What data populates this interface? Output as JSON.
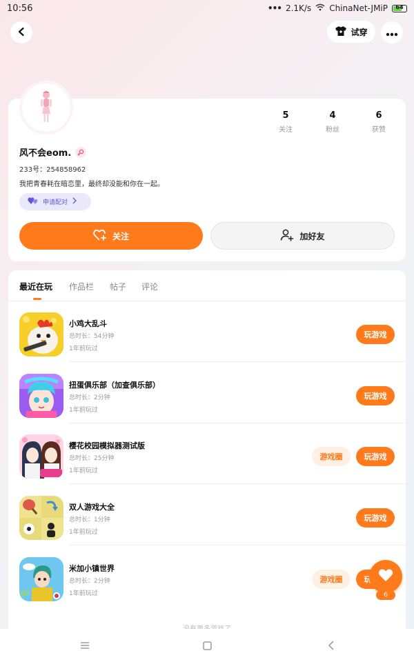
{
  "status_bar": {
    "time": "10:56",
    "speed": "2.1K/s",
    "network": "ChinaNet-JMiP",
    "battery": "64",
    "battery_level": 0.64
  },
  "header": {
    "back_icon": "back-arrow-icon",
    "tryon_label": "试穿",
    "tryon_icon": "shirt-icon",
    "more_icon": "more-dots-icon"
  },
  "profile": {
    "stats": [
      {
        "value": "5",
        "label": "关注"
      },
      {
        "value": "4",
        "label": "粉丝"
      },
      {
        "value": "6",
        "label": "获赞"
      }
    ],
    "username": "风不会eom.",
    "gender_icon": "female-symbol-icon",
    "id_text": "233号：254858962",
    "bio": "我把青春耗在暗恋里，最终却没能和你在一起。",
    "pair_label": "申请配对",
    "follow_label": "关注",
    "add_friend_label": "加好友"
  },
  "tabs": [
    "最近在玩",
    "作品栏",
    "帖子",
    "评论"
  ],
  "games": [
    {
      "name": "小鸡大乱斗",
      "time": "总时长：54分钟",
      "last": "1年前玩过",
      "circle": null,
      "play": "玩游戏"
    },
    {
      "name": "扭蛋俱乐部（加查俱乐部）",
      "time": "总时长：2分钟",
      "last": "1年前玩过",
      "circle": null,
      "play": "玩游戏"
    },
    {
      "name": "樱花校园模拟器测试版",
      "time": "总时长：25分钟",
      "last": "1年前玩过",
      "circle": "游戏圈",
      "play": "玩游戏"
    },
    {
      "name": "双人游戏大全",
      "time": "总时长：1分钟",
      "last": "1年前玩过",
      "circle": null,
      "play": "玩游戏"
    },
    {
      "name": "米加小镇世界",
      "time": "总时长：2分钟",
      "last": "1年前玩过",
      "circle": "游戏圈",
      "play": "玩游戏"
    }
  ],
  "fab": {
    "icon": "heart-icon",
    "count": "6"
  },
  "footer_hint": "没有更多游戏了",
  "colors": {
    "accent": "#ff7a1a",
    "pair": "#5d56d8"
  }
}
